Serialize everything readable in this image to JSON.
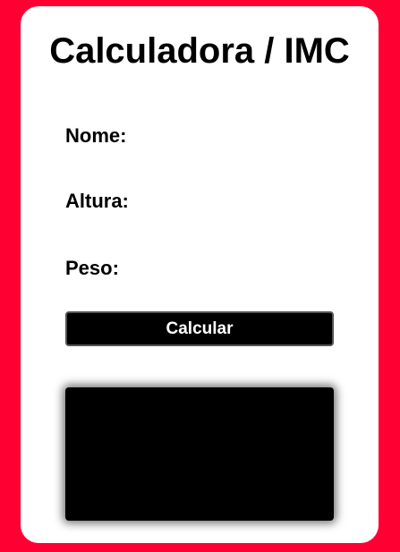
{
  "form": {
    "title": "Calculadora / IMC",
    "fields": {
      "nome_label": "Nome:",
      "altura_label": "Altura:",
      "peso_label": "Peso:"
    },
    "calculate_label": "Calcular",
    "result_text": ""
  },
  "colors": {
    "page_background": "#ff0033",
    "card_background": "#ffffff",
    "button_background": "#000000",
    "result_background": "#000000"
  }
}
